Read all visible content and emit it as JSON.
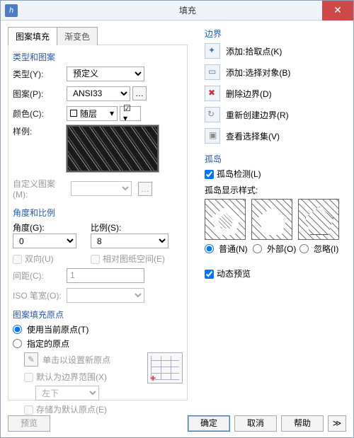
{
  "title": "填充",
  "tabs": {
    "hatch": "图案填充",
    "grad": "渐变色"
  },
  "group_type": "类型和图案",
  "type_lbl": "类型(Y):",
  "type_val": "预定义",
  "pattern_lbl": "图案(P):",
  "pattern_val": "ANSI33",
  "color_lbl": "颜色(C):",
  "color_val": "随层",
  "sample_lbl": "样例:",
  "custom_lbl": "自定义图案(M):",
  "group_angle": "角度和比例",
  "angle_lbl": "角度(G):",
  "angle_val": "0",
  "scale_lbl": "比例(S):",
  "scale_val": "8",
  "double_lbl": "双向(U)",
  "relpaper_lbl": "相对图纸空间(E)",
  "spacing_lbl": "间距(C):",
  "spacing_val": "1",
  "isopen_lbl": "ISO 笔宽(O):",
  "group_origin": "图案填充原点",
  "use_cur": "使用当前原点(T)",
  "spec_origin": "指定的原点",
  "click_set": "单击以设置新原点",
  "def_bound": "默认为边界范围(X)",
  "origin_pos": "左下",
  "store_def": "存储为默认原点(E)",
  "group_bound": "边界",
  "b1": "添加:拾取点(K)",
  "b2": "添加:选择对象(B)",
  "b3": "删除边界(D)",
  "b4": "重新创建边界(R)",
  "b5": "查看选择集(V)",
  "group_island": "孤岛",
  "isl_detect": "孤岛检测(L)",
  "isl_style": "孤岛显示样式:",
  "isl_normal": "普通(N)",
  "isl_outer": "外部(O)",
  "isl_ignore": "忽略(I)",
  "dyn_prev": "动态预览",
  "btn_prev": "预览",
  "btn_ok": "确定",
  "btn_cancel": "取消",
  "btn_help": "帮助"
}
